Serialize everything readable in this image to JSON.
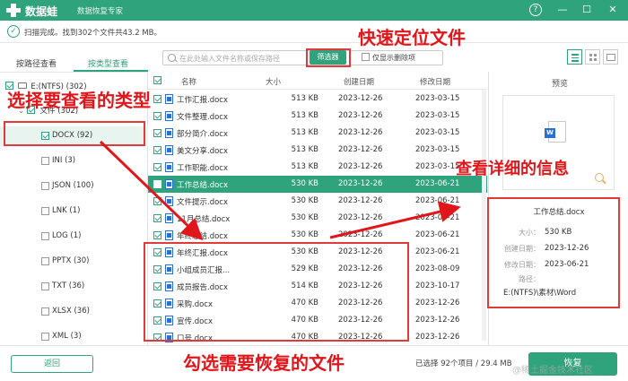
{
  "titlebar": {
    "app_name": "数据蛙",
    "app_sub": "数据恢复专家",
    "help_glyph": "?",
    "min_glyph": "—",
    "max_glyph": "☐",
    "close_glyph": "✕"
  },
  "status": {
    "text": "扫描完成。找到302个文件共43.2 MB。"
  },
  "left_tabs": {
    "by_path": "按路径查看",
    "by_type": "按类型查看"
  },
  "tree": {
    "drive": "E:(NTFS) (302)",
    "files": "文件 (302)"
  },
  "types": [
    {
      "label": "DOCX (92)",
      "checked": true
    },
    {
      "label": "INI (3)",
      "checked": false
    },
    {
      "label": "JSON (100)",
      "checked": false
    },
    {
      "label": "LNK (1)",
      "checked": false
    },
    {
      "label": "LOG (1)",
      "checked": false
    },
    {
      "label": "PPTX (30)",
      "checked": false
    },
    {
      "label": "TXT (36)",
      "checked": false
    },
    {
      "label": "XLSX (36)",
      "checked": false
    },
    {
      "label": "XML (3)",
      "checked": false
    }
  ],
  "toolbar": {
    "search_placeholder": "在此处输入文件名称或保存路径",
    "filter_label": "筛选器",
    "deleted_only_label": "仅显示删除项"
  },
  "table": {
    "headers": {
      "name": "名称",
      "size": "大小",
      "created": "创建日期",
      "modified": "修改日期"
    },
    "rows": [
      {
        "name": "工作汇报.docx",
        "size": "513 KB",
        "created": "2023-12-26",
        "modified": "2023-03-15"
      },
      {
        "name": "文件整理.docx",
        "size": "513 KB",
        "created": "2023-12-26",
        "modified": "2023-03-15"
      },
      {
        "name": "部分简介.docx",
        "size": "513 KB",
        "created": "2023-12-26",
        "modified": "2023-03-15"
      },
      {
        "name": "美文分享.docx",
        "size": "513 KB",
        "created": "2023-12-26",
        "modified": "2023-03-15"
      },
      {
        "name": "工作职能.docx",
        "size": "513 KB",
        "created": "2023-12-26",
        "modified": "2023-03-15"
      },
      {
        "name": "工作总结.docx",
        "size": "530 KB",
        "created": "2023-12-26",
        "modified": "2023-06-21"
      },
      {
        "name": "文件提示.docx",
        "size": "530 KB",
        "created": "2023-12-26",
        "modified": "2023-06-21"
      },
      {
        "name": "11月总结.docx",
        "size": "530 KB",
        "created": "2023-12-26",
        "modified": "2023-06-21"
      },
      {
        "name": "年终总结.docx",
        "size": "530 KB",
        "created": "2023-12-26",
        "modified": "2023-06-21"
      },
      {
        "name": "年终汇报.docx",
        "size": "530 KB",
        "created": "2023-12-26",
        "modified": "2023-06-21"
      },
      {
        "name": "小组成员汇报...",
        "size": "529 KB",
        "created": "2023-12-26",
        "modified": "2023-08-09"
      },
      {
        "name": "成员报告.docx",
        "size": "514 KB",
        "created": "2023-12-26",
        "modified": "2023-10-17"
      },
      {
        "name": "采购.docx",
        "size": "470 KB",
        "created": "2023-12-26",
        "modified": "2023-12-26"
      },
      {
        "name": "宣传.docx",
        "size": "470 KB",
        "created": "2023-12-26",
        "modified": "2023-12-26"
      },
      {
        "name": "口号.docx",
        "size": "470 KB",
        "created": "2023-12-26",
        "modified": "2023-12-26"
      }
    ]
  },
  "preview": {
    "title": "预览",
    "file_name": "工作总结.docx",
    "size_label": "大小：",
    "size_value": "530 KB",
    "created_label": "创建日期：",
    "created_value": "2023-12-26",
    "modified_label": "修改日期：",
    "modified_value": "2023-06-21",
    "path_label": "路径：",
    "path_value": "E:(NTFS)\\素材\\Word"
  },
  "bottom": {
    "back_label": "返回",
    "selected_text": "已选择 92个项目 / 29.4 MB",
    "recover_label": "恢复",
    "watermark": "@稀土掘金技术社区"
  },
  "annotations": {
    "quick_locate": "快速定位文件",
    "select_type": "选择要查看的类型",
    "view_info": "查看详细的信息",
    "check_recover": "勾选需要恢复的文件"
  },
  "colors": {
    "brand": "#2fa37c",
    "annotation": "#e0161b"
  }
}
